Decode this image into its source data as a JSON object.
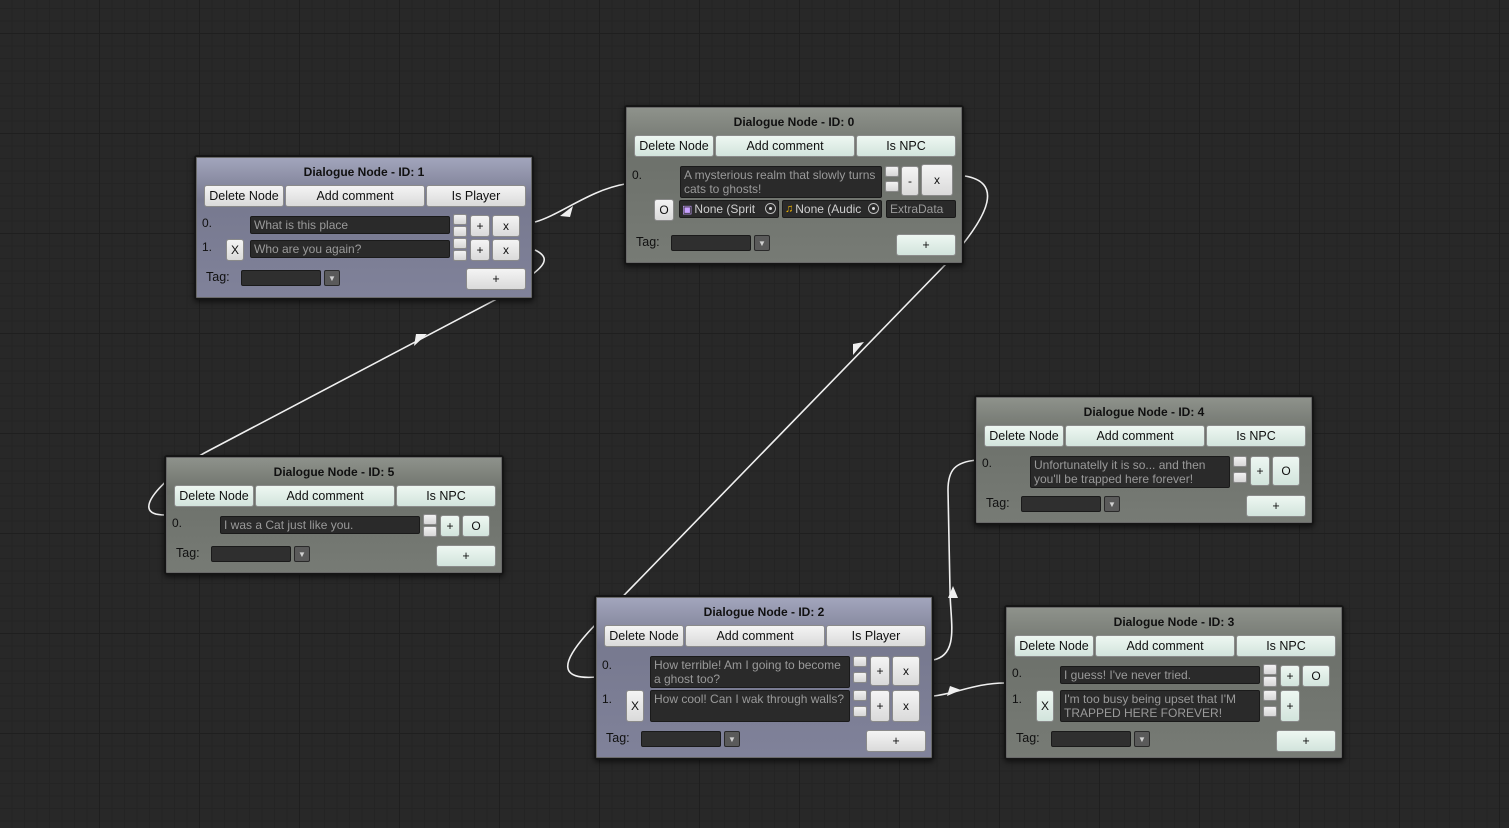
{
  "nodes": {
    "n1": {
      "title": "Dialogue Node - ID: 1",
      "delete": "Delete Node",
      "comment": "Add comment",
      "role": "Is Player",
      "rows": [
        {
          "index": "0.",
          "text": "What is this place",
          "b1": "+",
          "b2": "x"
        },
        {
          "index": "1.",
          "mark": "X",
          "text": "Who are you again?",
          "b1": "+",
          "b2": "x"
        }
      ],
      "tag": "Tag:",
      "add": "+"
    },
    "n0": {
      "title": "Dialogue Node - ID: 0",
      "delete": "Delete Node",
      "comment": "Add comment",
      "role": "Is NPC",
      "rows": [
        {
          "index": "0.",
          "text": "A mysterious realm that slowly turns cats to ghosts!",
          "b1": "-",
          "b2": "x",
          "mark": "O"
        }
      ],
      "sprite": "None (Sprit",
      "audio": "None (Audic",
      "extra": "ExtraData",
      "tag": "Tag:",
      "add": "+"
    },
    "n5": {
      "title": "Dialogue Node - ID: 5",
      "delete": "Delete Node",
      "comment": "Add comment",
      "role": "Is NPC",
      "rows": [
        {
          "index": "0.",
          "text": "I was a Cat just like you.",
          "b1": "+",
          "b2": "O"
        }
      ],
      "tag": "Tag:",
      "add": "+"
    },
    "n4": {
      "title": "Dialogue Node - ID: 4",
      "delete": "Delete Node",
      "comment": "Add comment",
      "role": "Is NPC",
      "rows": [
        {
          "index": "0.",
          "text": "Unfortunatelly it is so... and then you'll be trapped here forever!",
          "b1": "+",
          "b2": "O"
        }
      ],
      "tag": "Tag:",
      "add": "+"
    },
    "n2": {
      "title": "Dialogue Node - ID: 2",
      "delete": "Delete Node",
      "comment": "Add comment",
      "role": "Is Player",
      "rows": [
        {
          "index": "0.",
          "text": "How terrible! Am I going to become a ghost too?",
          "b1": "+",
          "b2": "x"
        },
        {
          "index": "1.",
          "mark": "X",
          "text": "How cool! Can I wak through walls?",
          "b1": "+",
          "b2": "x"
        }
      ],
      "tag": "Tag:",
      "add": "+"
    },
    "n3": {
      "title": "Dialogue Node - ID: 3",
      "delete": "Delete Node",
      "comment": "Add comment",
      "role": "Is NPC",
      "rows": [
        {
          "index": "0.",
          "text": "I guess! I've never tried.",
          "b1": "+",
          "b2": "O"
        },
        {
          "index": "1.",
          "mark": "X",
          "text": "I'm too busy being upset that I'M TRAPPED HERE FOREVER!",
          "b1": "+"
        }
      ],
      "tag": "Tag:",
      "add": "+"
    }
  },
  "colors": {
    "canvas": "#282828",
    "npc_node": "#777b75",
    "player_node": "#80829a",
    "link": "#f0f0f0"
  }
}
